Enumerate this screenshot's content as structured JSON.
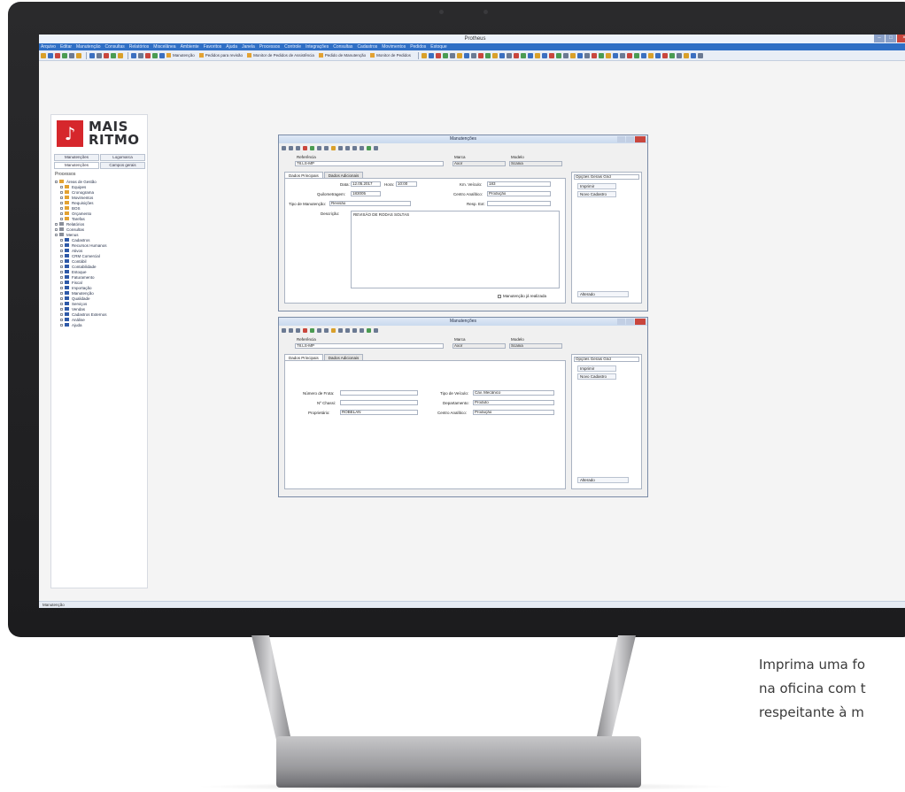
{
  "app": {
    "window_title": "Protheus",
    "menu": [
      "Arquivo",
      "Editar",
      "Manutenção",
      "Consultas",
      "Relatórios",
      "Miscelânea",
      "Ambiente",
      "Favoritos",
      "Ajuda",
      "Janela",
      "Processos",
      "Controle",
      "Integrações",
      "Consultas",
      "Cadastros",
      "Movimentos",
      "Pedidos",
      "Estoque"
    ],
    "toolbar_buttons": [
      "Manutenção",
      "Pedidos para revisão",
      "Monitor de Pedidos de Assistência",
      "Pedido de Manutenção",
      "Monitor de Pedidos"
    ],
    "status_text": "Manutenção"
  },
  "logo": {
    "line1": "MAIS",
    "line2": "RITMO",
    "symbol": "♪"
  },
  "left_panel": {
    "tabs_row1": [
      "Manutenções",
      "Logomarca"
    ],
    "tabs_row2": [
      "Manutenções",
      "Campos gerais"
    ],
    "label": "Processos",
    "tree": [
      {
        "level": 0,
        "label": "Áreas de Gestão",
        "color": "#e3a232"
      },
      {
        "level": 1,
        "label": "Equipes",
        "color": "#e3a232"
      },
      {
        "level": 1,
        "label": "Cronograma",
        "color": "#e3a232"
      },
      {
        "level": 1,
        "label": "Movimentos",
        "color": "#e3a232"
      },
      {
        "level": 1,
        "label": "Requisições",
        "color": "#e3a232"
      },
      {
        "level": 1,
        "label": "BOS",
        "color": "#e3a232"
      },
      {
        "level": 1,
        "label": "Orçamento",
        "color": "#e3a232"
      },
      {
        "level": 1,
        "label": "Tarefas",
        "color": "#e3a232"
      },
      {
        "level": 0,
        "label": "Relatórios",
        "color": "#8a8f99"
      },
      {
        "level": 0,
        "label": "Consultas",
        "color": "#8a8f99"
      },
      {
        "level": 0,
        "label": "Menus",
        "color": "#8a8f99"
      },
      {
        "level": 1,
        "label": "Cadastros",
        "color": "#2f5aa8"
      },
      {
        "level": 1,
        "label": "Recursos Humanos",
        "color": "#2f5aa8"
      },
      {
        "level": 1,
        "label": "Ativos",
        "color": "#2f5aa8"
      },
      {
        "level": 1,
        "label": "CRM Comercial",
        "color": "#2f5aa8"
      },
      {
        "level": 1,
        "label": "Contábil",
        "color": "#2f5aa8"
      },
      {
        "level": 1,
        "label": "Contabilidade",
        "color": "#2f5aa8"
      },
      {
        "level": 1,
        "label": "Estoque",
        "color": "#2f5aa8"
      },
      {
        "level": 1,
        "label": "Faturamento",
        "color": "#2f5aa8"
      },
      {
        "level": 1,
        "label": "Fiscal",
        "color": "#2f5aa8"
      },
      {
        "level": 1,
        "label": "Importação",
        "color": "#2f5aa8"
      },
      {
        "level": 1,
        "label": "Manutenção",
        "color": "#2f5aa8"
      },
      {
        "level": 1,
        "label": "Qualidade",
        "color": "#2f5aa8"
      },
      {
        "level": 1,
        "label": "Serviços",
        "color": "#2f5aa8"
      },
      {
        "level": 1,
        "label": "Vendas",
        "color": "#2f5aa8"
      },
      {
        "level": 1,
        "label": "Cadastros Externos",
        "color": "#2f5aa8"
      },
      {
        "level": 1,
        "label": "Análise",
        "color": "#2f5aa8"
      },
      {
        "level": 1,
        "label": "Ajuda",
        "color": "#2f5aa8"
      }
    ]
  },
  "win1": {
    "title": "Manutenções",
    "hdr_labels": [
      "Referência",
      "Marca",
      "Modelo"
    ],
    "hdr_values": [
      "78.LS-MP",
      "Axor",
      "Scania"
    ],
    "tabs": [
      "Dados Principais",
      "Dados Adicionais"
    ],
    "fields": {
      "data_label": "Data:",
      "data_value": "12.05.2017",
      "hora_label": "Hora:",
      "hora_value": "10:00",
      "km_label": "Km. Veículo:",
      "km_value": "183",
      "quilometro_label": "Quilometragem:",
      "quilometro_value": "183005",
      "custo_label": "Centro Analítico:",
      "custo_value": "Produção",
      "tipo_label": "Tipo de Manutenção:",
      "tipo_value": "Revisão",
      "resp_label": "Resp. Ext:",
      "desc_label": "Descrição:",
      "desc_value": "REVISÃO DE RODAS SOLTAS"
    },
    "checkbox": "Manutenção já realizada",
    "side_select": "Opções Gerais Grid",
    "side_buttons": [
      "Imprimir",
      "Novo Cadastro"
    ],
    "side_bottom": "Alterado"
  },
  "win2": {
    "title": "Manutenções",
    "hdr_labels": [
      "Referência",
      "Marca",
      "Modelo"
    ],
    "hdr_values": [
      "78.LS-MP",
      "Axor",
      "Scania"
    ],
    "tabs": [
      "Dados Principais",
      "Dados Adicionais"
    ],
    "left_labels": [
      "Número de Frota:",
      "Nº Chassi:",
      "Proprietário:"
    ],
    "left_values": [
      "",
      "",
      "ROBELAN"
    ],
    "right_labels": [
      "Tipo de Veículo:",
      "Departamento:",
      "Centro Analítico:"
    ],
    "right_values": [
      "Cav. Mecânico",
      "Produto",
      "Produção"
    ],
    "side_select": "Opções Gerais Grid",
    "side_buttons": [
      "Imprimir",
      "Novo Cadastro"
    ],
    "side_bottom": "Alterado"
  },
  "caption": {
    "line1": "Imprima uma fo",
    "line2": "na oficina com t",
    "line3": "respeitante à m"
  },
  "colors": {
    "brand_red": "#d6272c",
    "menubar_blue": "#2f6fc5",
    "monitor": "#1c1c1e"
  }
}
